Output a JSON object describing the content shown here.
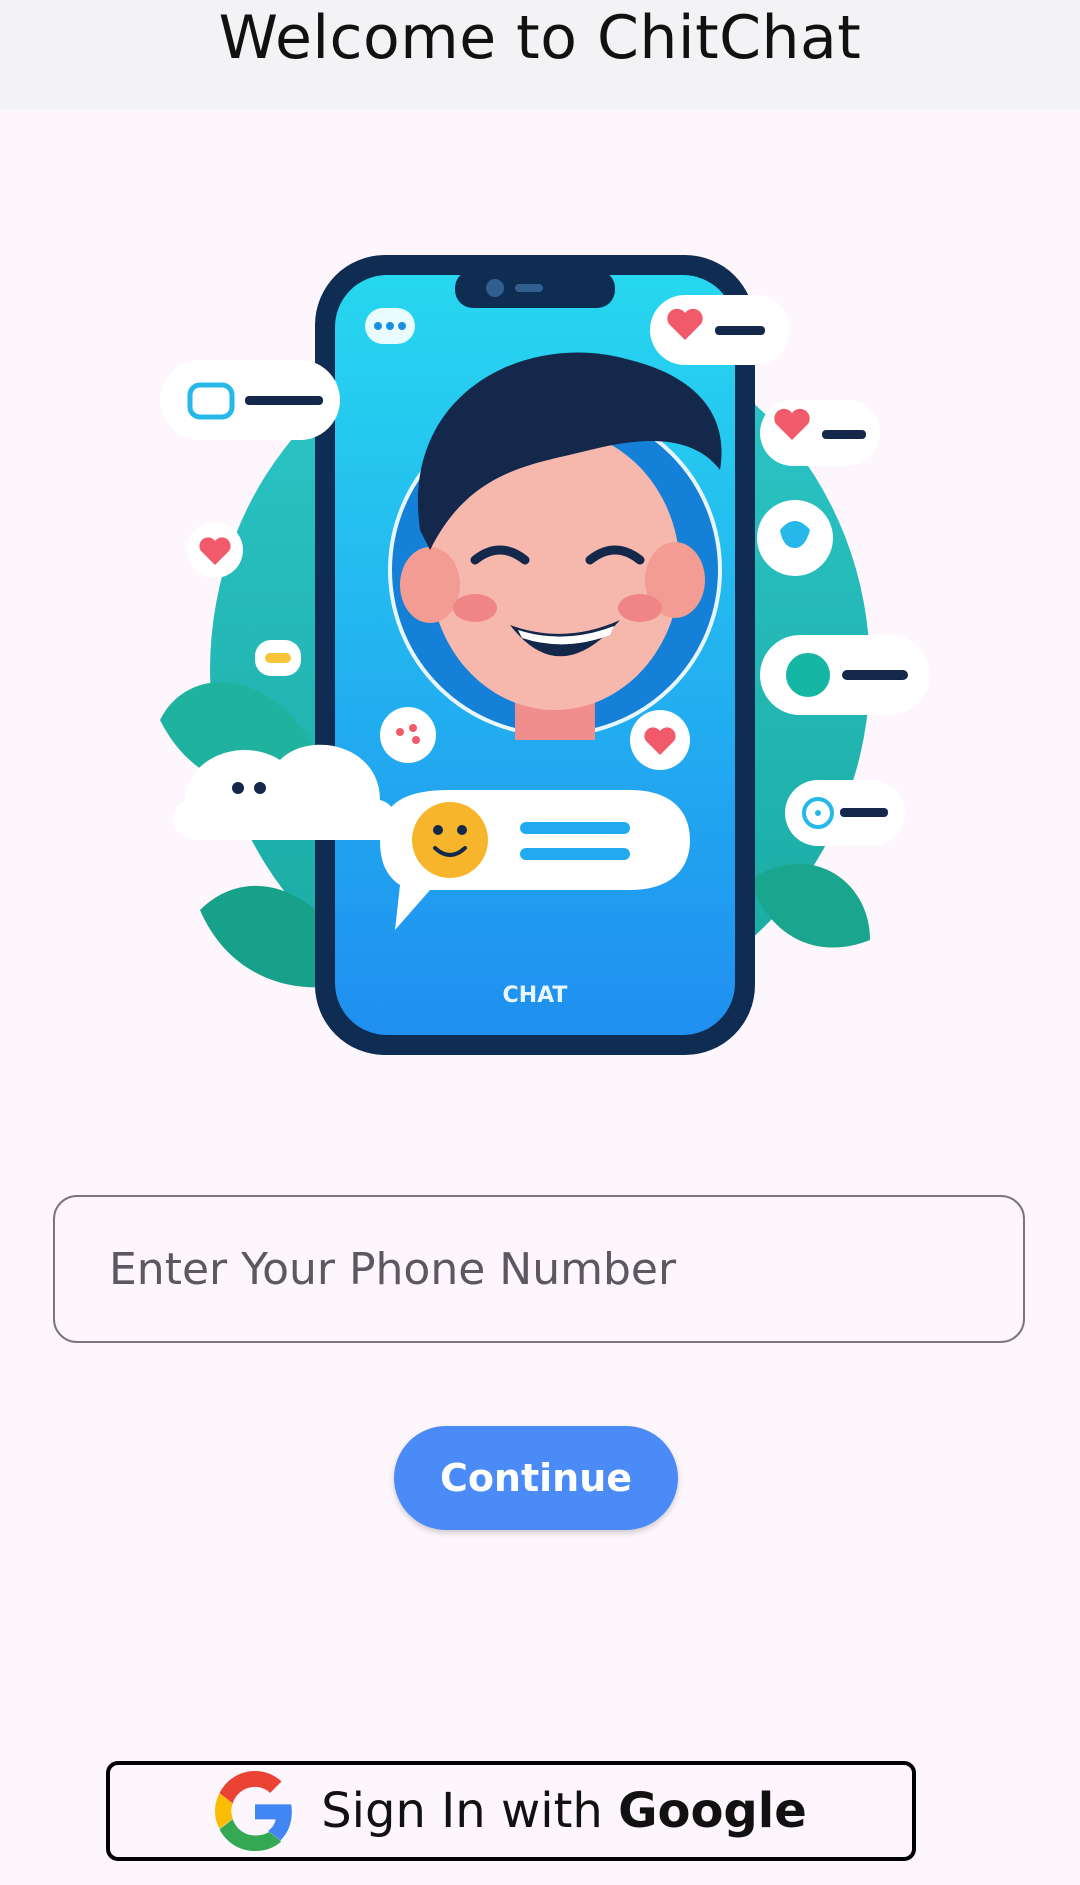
{
  "appbar": {
    "title": "Welcome to ChitChat"
  },
  "illustration": {
    "phone_caption": "CHAT"
  },
  "phone_input": {
    "placeholder": "Enter Your Phone Number",
    "value": ""
  },
  "continue_button": {
    "label": "Continue"
  },
  "google_button": {
    "label_prefix": "Sign In with ",
    "label_brand": "Google",
    "icon": "google-g-icon"
  },
  "colors": {
    "accent": "#4a8bf7",
    "background": "#fdf6fc",
    "appbar": "#f3f2f5"
  }
}
